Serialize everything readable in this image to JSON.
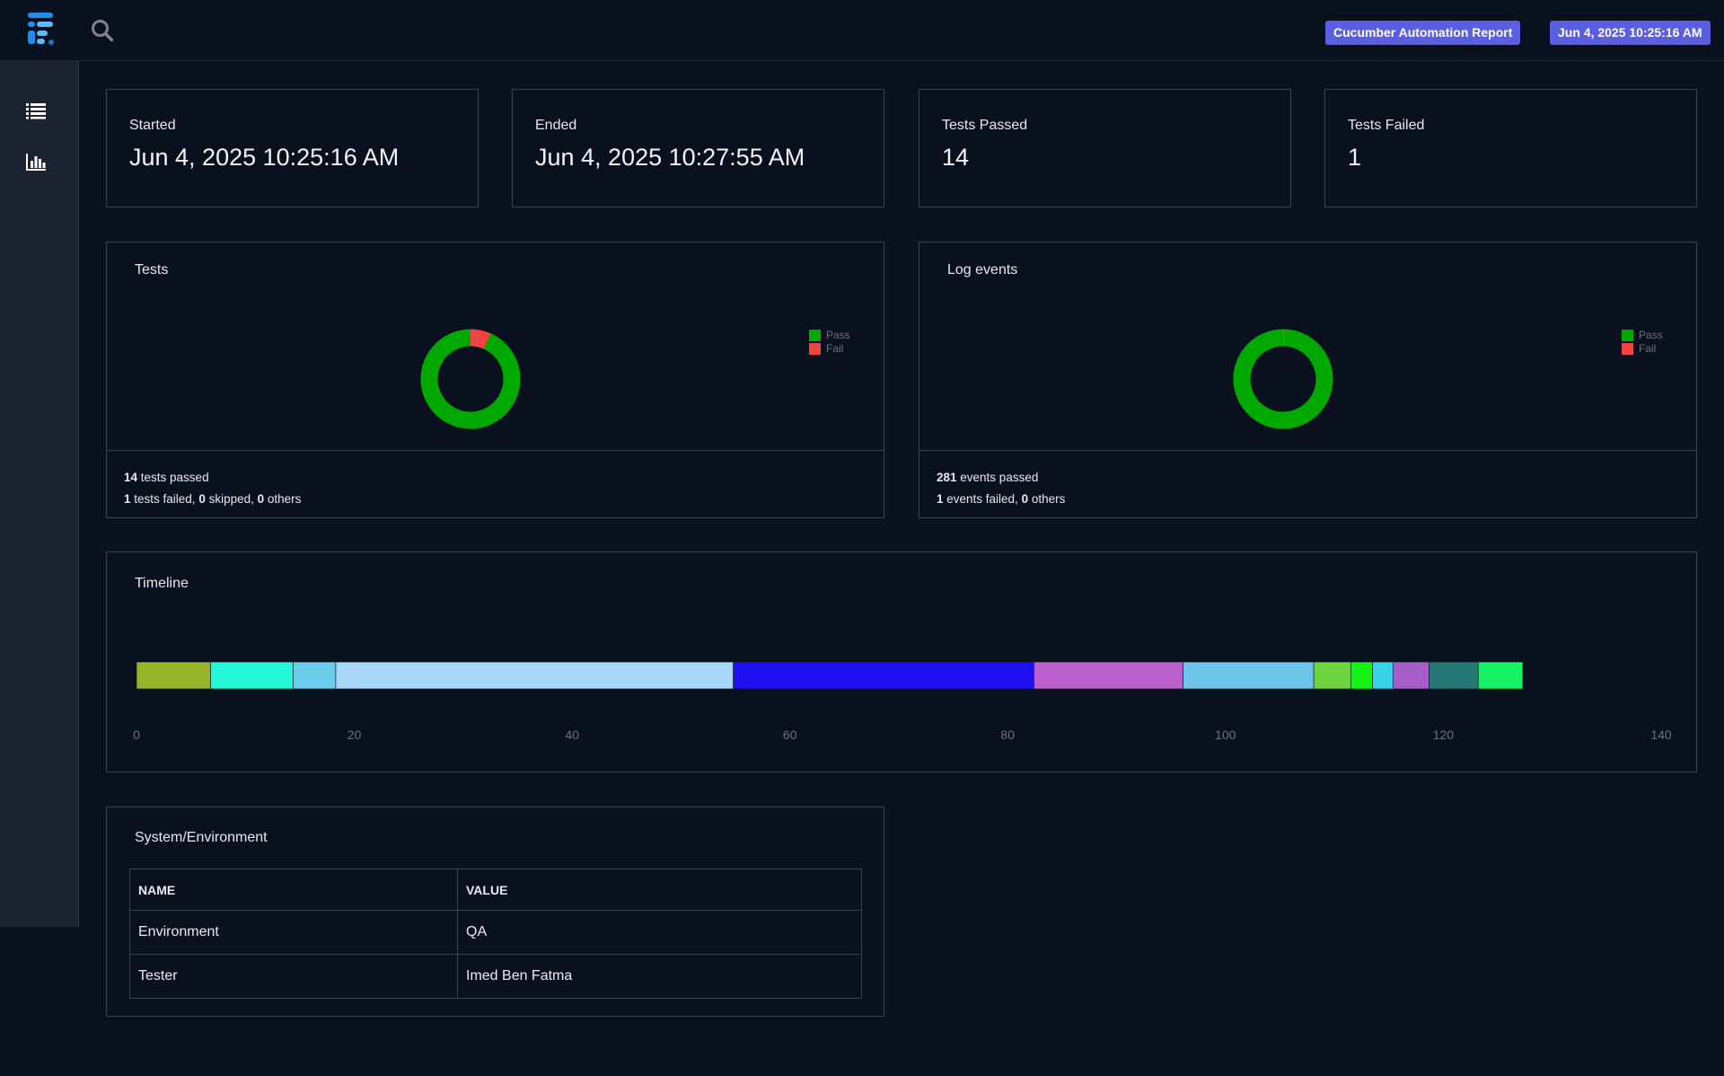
{
  "header": {
    "report_name": "Cucumber Automation Report",
    "report_date": "Jun 4, 2025 10:25:16 AM",
    "logo_icon": "extent-logo-icon",
    "search_icon": "search-icon"
  },
  "sidebar": {
    "items": [
      {
        "icon": "list-icon",
        "label": "Tests"
      },
      {
        "icon": "bar-chart-icon",
        "label": "Dashboard"
      }
    ]
  },
  "stats": {
    "started": {
      "label": "Started",
      "value": "Jun 4, 2025 10:25:16 AM"
    },
    "ended": {
      "label": "Ended",
      "value": "Jun 4, 2025 10:27:55 AM"
    },
    "passed": {
      "label": "Tests Passed",
      "value": "14"
    },
    "failed": {
      "label": "Tests Failed",
      "value": "1"
    }
  },
  "tests_panel": {
    "title": "Tests",
    "legend": [
      {
        "label": "Pass",
        "color": "#00a800"
      },
      {
        "label": "Fail",
        "color": "#ef4444"
      }
    ],
    "pass": 14,
    "fail": 1,
    "line1": {
      "num": "14",
      "text": " tests passed"
    },
    "line2": {
      "num1": "1",
      "text1": " tests failed, ",
      "num2": "0",
      "text2": " skipped, ",
      "num3": "0",
      "text3": " others"
    }
  },
  "log_panel": {
    "title": "Log events",
    "legend": [
      {
        "label": "Pass",
        "color": "#00a800"
      },
      {
        "label": "Fail",
        "color": "#ef4444"
      }
    ],
    "pass": 281,
    "fail": 1,
    "line1": {
      "num": "281",
      "text": " events passed"
    },
    "line2": {
      "num1": "1",
      "text1": " events failed, ",
      "num2": "0",
      "text2": " others"
    }
  },
  "chart_data": [
    {
      "type": "pie",
      "title": "Tests",
      "labels": [
        "Pass",
        "Fail"
      ],
      "values": [
        14,
        1
      ],
      "colors": [
        "#00a800",
        "#ef4444"
      ],
      "legend": "right"
    },
    {
      "type": "pie",
      "title": "Log events",
      "labels": [
        "Pass",
        "Fail"
      ],
      "values": [
        281,
        1
      ],
      "colors": [
        "#00a800",
        "#ef4444"
      ],
      "legend": "right"
    },
    {
      "type": "bar",
      "orientation": "horizontal-stacked",
      "title": "Timeline",
      "xlim": [
        0,
        140
      ],
      "xticks": [
        0,
        20,
        40,
        60,
        80,
        100,
        120,
        140
      ],
      "segments": [
        {
          "start": 0,
          "end": 6.8,
          "color": "#97b52b"
        },
        {
          "start": 6.8,
          "end": 14.4,
          "color": "#23f7d6"
        },
        {
          "start": 14.4,
          "end": 18.3,
          "color": "#6bcdec"
        },
        {
          "start": 18.3,
          "end": 54.8,
          "color": "#a8d7fa"
        },
        {
          "start": 54.8,
          "end": 82.4,
          "color": "#1e0ff0"
        },
        {
          "start": 82.4,
          "end": 96.1,
          "color": "#bb5fce"
        },
        {
          "start": 96.1,
          "end": 108.1,
          "color": "#6dc6ea"
        },
        {
          "start": 108.1,
          "end": 111.5,
          "color": "#6ed43d"
        },
        {
          "start": 111.5,
          "end": 113.5,
          "color": "#12f412"
        },
        {
          "start": 113.5,
          "end": 115.4,
          "color": "#36d3e8"
        },
        {
          "start": 115.4,
          "end": 118.7,
          "color": "#a75ec8"
        },
        {
          "start": 118.7,
          "end": 123.2,
          "color": "#247774"
        },
        {
          "start": 123.2,
          "end": 127.3,
          "color": "#16f263"
        }
      ]
    }
  ],
  "environment": {
    "title": "System/Environment",
    "columns": [
      "NAME",
      "VALUE"
    ],
    "rows": [
      [
        "Environment",
        "QA"
      ],
      [
        "Tester",
        "Imed Ben Fatma"
      ]
    ]
  }
}
